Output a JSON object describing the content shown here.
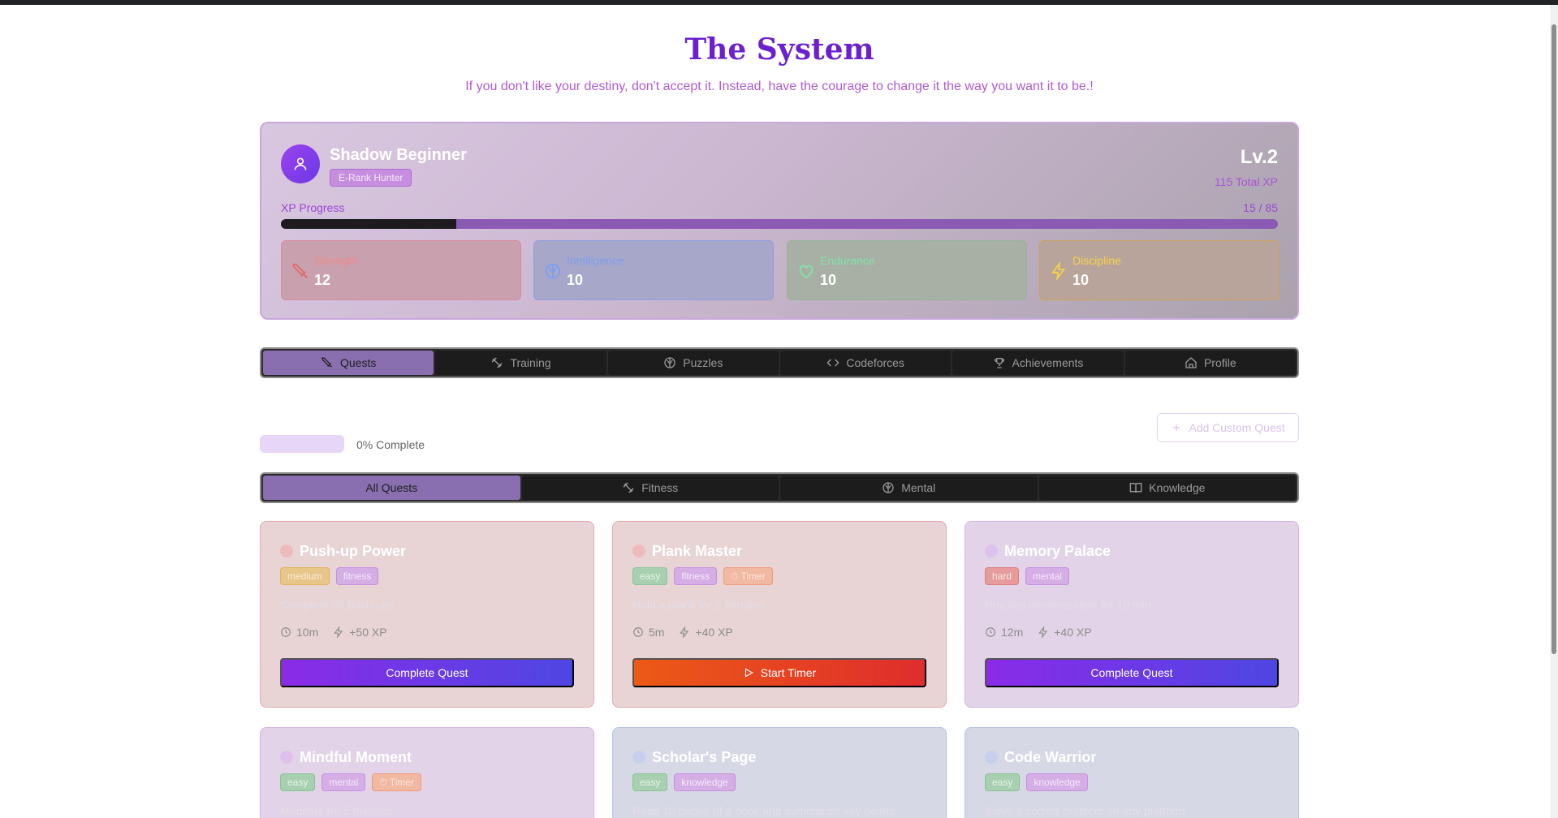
{
  "header": {
    "title": "The System",
    "subtitle": "If you don't like your destiny, don't accept it. Instead, have the courage to change it the way you want it to be.!"
  },
  "profile": {
    "name": "Shadow Beginner",
    "rank": "E-Rank Hunter",
    "level": "Lv.2",
    "total_xp": "115 Total XP",
    "xp_label": "XP Progress",
    "xp_count": "15 / 85",
    "xp_fraction": 0.176,
    "stats": [
      {
        "label": "Strength",
        "value": "12",
        "icon": "sword-icon",
        "color": "#f08a8a"
      },
      {
        "label": "Intelligence",
        "value": "10",
        "icon": "brain-icon",
        "color": "#7d9ff0"
      },
      {
        "label": "Endurance",
        "value": "10",
        "icon": "heart-icon",
        "color": "#7fe4a8"
      },
      {
        "label": "Discipline",
        "value": "10",
        "icon": "lightning-icon",
        "color": "#f7d24a"
      }
    ]
  },
  "tabs": [
    {
      "label": "Quests",
      "icon": "sword-icon",
      "active": true
    },
    {
      "label": "Training",
      "icon": "dumbbell-icon"
    },
    {
      "label": "Puzzles",
      "icon": "brain-icon"
    },
    {
      "label": "Codeforces",
      "icon": "code-icon"
    },
    {
      "label": "Achievements",
      "icon": "trophy-icon"
    },
    {
      "label": "Profile",
      "icon": "home-icon"
    }
  ],
  "quests_panel": {
    "progress_text": "0% Complete",
    "progress_fraction": 0,
    "add_button": "Add Custom Quest",
    "filters": [
      {
        "label": "All Quests",
        "active": true
      },
      {
        "label": "Fitness",
        "icon": "dumbbell-icon"
      },
      {
        "label": "Mental",
        "icon": "brain-icon"
      },
      {
        "label": "Knowledge",
        "icon": "book-icon"
      }
    ]
  },
  "quests": [
    {
      "title": "Push-up Power",
      "tags": [
        "medium",
        "fitness"
      ],
      "desc": "Complete 20 push-ups",
      "time": "10m",
      "xp": "+50 XP",
      "action": "Complete Quest"
    },
    {
      "title": "Plank Master",
      "tags": [
        "easy",
        "fitness",
        "Timer"
      ],
      "desc": "Hold a plank for 2 minutes",
      "time": "5m",
      "xp": "+40 XP",
      "action": "Start Timer"
    },
    {
      "title": "Memory Palace",
      "tags": [
        "hard",
        "mental"
      ],
      "desc": "Practice memorization for 10 min",
      "time": "12m",
      "xp": "+40 XP",
      "action": "Complete Quest"
    },
    {
      "title": "Mindful Moment",
      "tags": [
        "easy",
        "mental",
        "Timer"
      ],
      "desc": "Meditate for 5 minutes"
    },
    {
      "title": "Scholar's Page",
      "tags": [
        "easy",
        "knowledge"
      ],
      "desc": "Read 10 pages of a book and summarize key points"
    },
    {
      "title": "Code Warrior",
      "tags": [
        "easy",
        "knowledge"
      ],
      "desc": "Solve a coding problem on any platform"
    }
  ]
}
